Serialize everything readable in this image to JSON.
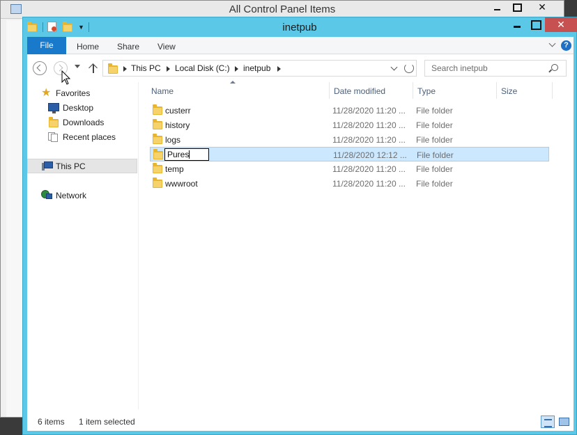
{
  "background_window": {
    "title": "All Control Panel Items"
  },
  "window": {
    "title": "inetpub"
  },
  "ribbon": {
    "file_tab": "File",
    "tabs": [
      "Home",
      "Share",
      "View"
    ],
    "help": "?"
  },
  "address_bar": {
    "breadcrumbs": [
      "This PC",
      "Local Disk (C:)",
      "inetpub"
    ]
  },
  "search": {
    "placeholder": "Search inetpub"
  },
  "nav_pane": {
    "favorites_label": "Favorites",
    "favorites": [
      "Desktop",
      "Downloads",
      "Recent places"
    ],
    "this_pc": "This PC",
    "network": "Network"
  },
  "columns": [
    "Name",
    "Date modified",
    "Type",
    "Size"
  ],
  "files": [
    {
      "name": "custerr",
      "date": "11/28/2020 11:20 ...",
      "type": "File folder"
    },
    {
      "name": "history",
      "date": "11/28/2020 11:20 ...",
      "type": "File folder"
    },
    {
      "name": "logs",
      "date": "11/28/2020 11:20 ...",
      "type": "File folder"
    },
    {
      "name": "Pures",
      "date": "11/28/2020 12:12 ...",
      "type": "File folder",
      "selected": true,
      "renaming": true
    },
    {
      "name": "temp",
      "date": "11/28/2020 11:20 ...",
      "type": "File folder"
    },
    {
      "name": "wwwroot",
      "date": "11/28/2020 11:20 ...",
      "type": "File folder"
    }
  ],
  "status_bar": {
    "item_count": "6 items",
    "selection": "1 item selected"
  },
  "colors": {
    "title_bar": "#5bc8e8",
    "file_tab": "#1979ca",
    "close_button": "#c75050",
    "selection": "#cce8ff"
  }
}
